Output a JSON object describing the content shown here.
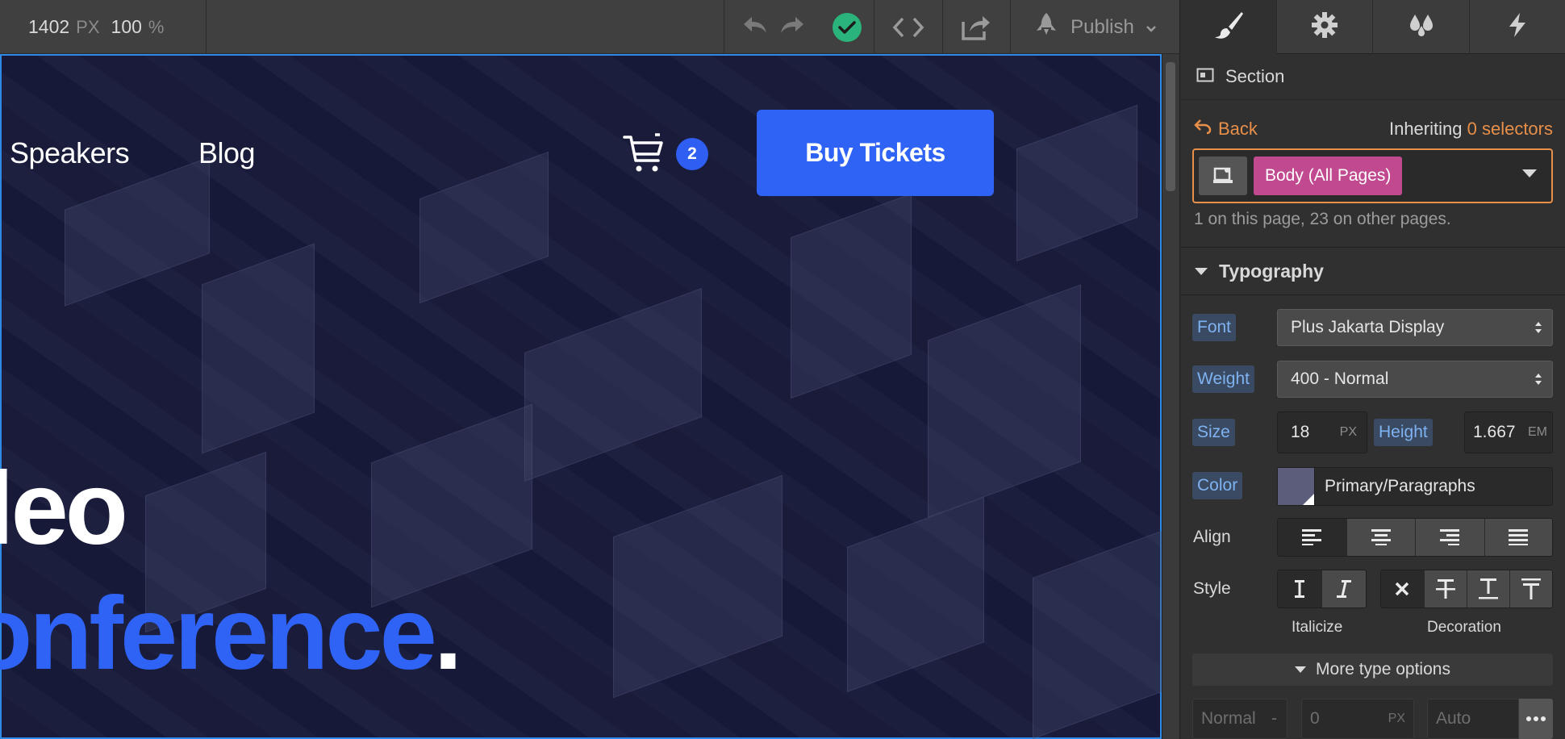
{
  "toolbar": {
    "width_value": "1402",
    "width_unit": "PX",
    "zoom_value": "100",
    "zoom_unit": "%",
    "publish_label": "Publish"
  },
  "canvas": {
    "nav_links": [
      "Speakers",
      "Blog"
    ],
    "cart_count": "2",
    "buy_button": "Buy Tickets",
    "hero_line1": "leo",
    "hero_line2": "onference",
    "hero_line2_end": "."
  },
  "panel": {
    "element_type": "Section",
    "back_label": "Back",
    "inheriting_prefix": "Inheriting",
    "inheriting_count": "0 selectors",
    "selector_tag": "Body (All Pages)",
    "usage_text": "1 on this page, 23 on other pages.",
    "section_title": "Typography",
    "font_label": "Font",
    "font_value": "Plus Jakarta Display",
    "weight_label": "Weight",
    "weight_value": "400 - Normal",
    "size_label": "Size",
    "size_value": "18",
    "size_unit": "PX",
    "height_label": "Height",
    "height_value": "1.667",
    "height_unit": "EM",
    "color_label": "Color",
    "color_value": "Primary/Paragraphs",
    "align_label": "Align",
    "style_label": "Style",
    "italicize_caption": "Italicize",
    "decoration_caption": "Decoration",
    "more_options": "More type options",
    "bottom_fields": [
      {
        "value": "Normal",
        "suffix": "-"
      },
      {
        "value": "0",
        "suffix": "PX"
      },
      {
        "value": "Auto",
        "suffix": ""
      }
    ]
  },
  "colors": {
    "accent_blue": "#2f63f5",
    "selector_orange": "#e88f49",
    "tag_pink": "#c0498f",
    "status_green": "#2ab37a"
  }
}
